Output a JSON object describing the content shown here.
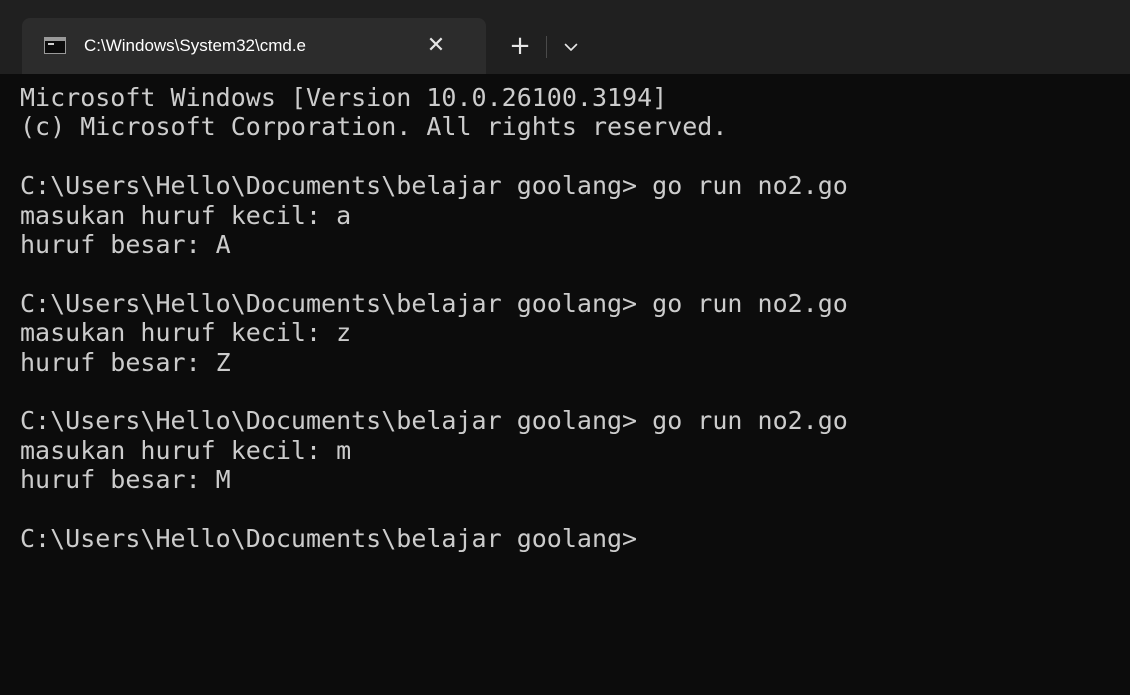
{
  "tab": {
    "title": "C:\\Windows\\System32\\cmd.e",
    "icon": "command-prompt-icon",
    "close_glyph": "✕"
  },
  "toolbar": {
    "new_tab_glyph": "+",
    "dropdown_icon": "chevron-down-icon"
  },
  "console": {
    "lines": [
      "Microsoft Windows [Version 10.0.26100.3194]",
      "(c) Microsoft Corporation. All rights reserved.",
      "",
      "C:\\Users\\Hello\\Documents\\belajar goolang> go run no2.go",
      "masukan huruf kecil: a",
      "huruf besar: A",
      "",
      "C:\\Users\\Hello\\Documents\\belajar goolang> go run no2.go",
      "masukan huruf kecil: z",
      "huruf besar: Z",
      "",
      "C:\\Users\\Hello\\Documents\\belajar goolang> go run no2.go",
      "masukan huruf kecil: m",
      "huruf besar: M",
      "",
      "C:\\Users\\Hello\\Documents\\belajar goolang>"
    ]
  },
  "colors": {
    "background": "#0c0c0c",
    "titlebar": "#202020",
    "tab": "#2c2c2c",
    "text": "#cccccc"
  }
}
